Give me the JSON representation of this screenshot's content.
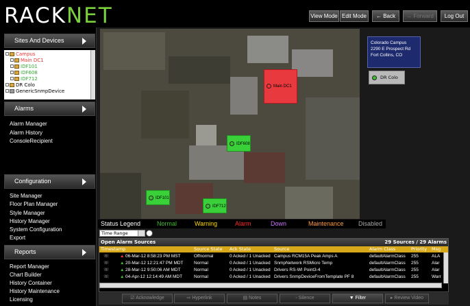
{
  "brand": {
    "logo_white": "RACK",
    "logo_green": "NET"
  },
  "topnav": {
    "view_mode": "View Mode",
    "edit_mode": "Edit Mode",
    "back": "← Back",
    "forward": "→ Forward",
    "logout": "Log Out"
  },
  "sidebar": {
    "sites_header": "Sites And Devices",
    "tree": [
      "Campus",
      "Main DC1",
      "IDF101",
      "IDF608",
      "IDF712",
      "DR Colo",
      "GenericSnmpDevice"
    ],
    "alarms_header": "Alarms",
    "alarm_links": [
      "Alarm Manager",
      "Alarm History",
      "ConsoleRecipient"
    ],
    "config_header": "Configuration",
    "config_links": [
      "Site Manager",
      "Floor Plan Manager",
      "Style Manager",
      "History Manager",
      "System Configuration",
      "Export"
    ],
    "reports_header": "Reports",
    "report_links": [
      "Report Manager",
      "Chart Builder",
      "History Container",
      "History Maintenance",
      "Licensing"
    ]
  },
  "map": {
    "location": {
      "name": "Colorado Campus",
      "address1": "2290 E Prospect Rd",
      "address2": "Fort Collins, CO"
    },
    "dr_colo": "DR Colo",
    "zones": {
      "main_dc1": "Main DC1",
      "idf608": "IDF608",
      "idf101": "IDF101",
      "idf712": "IDF712"
    }
  },
  "legend": {
    "title": "Status Legend",
    "normal": "Normal",
    "warning": "Warning",
    "alarm": "Alarm",
    "down": "Down",
    "maintenance": "Maintenance",
    "disabled": "Disabled"
  },
  "colors": {
    "normal": "#3fbf2f",
    "warning": "#ffd800",
    "alarm": "#ff2a2a",
    "down": "#d070ff",
    "maintenance": "#ff9a3c",
    "disabled": "#aaaaaa",
    "header_gold": "#d6a81a"
  },
  "time_range": "Time Range",
  "alarms_panel": {
    "title": "Open Alarm Sources",
    "count": "29 Sources / 29 Alarms",
    "columns": [
      "Timestamp",
      "Source State",
      "Ack State",
      "Source",
      "Alarm Class",
      "Priority",
      "Msg"
    ],
    "rows": [
      [
        "06-Mar-12 8:58:23 PM MST",
        "Offnormal",
        "0 Acked / 1 Unacked",
        "Campus RCM15A Peak Amps A",
        "defaultAlarmClass",
        "255",
        "ALA"
      ],
      [
        "20-Mar-12 12:21:47 PM MDT",
        "Normal",
        "0 Acked / 1 Unacked",
        "SnmpNetwork RSMicro Temp",
        "defaultAlarmClass",
        "255",
        "Alar"
      ],
      [
        "28-Mar-12 9:50:06 AM MDT",
        "Normal",
        "0 Acked / 1 Unacked",
        "Drivers RS-WI Point3-4",
        "defaultAlarmClass",
        "255",
        "Alar"
      ],
      [
        "04-Apr-12 12:14:49 AM MDT",
        "Normal",
        "0 Acked / 1 Unacked",
        "Drivers SnmpDeviceFromTemplate PF 8",
        "defaultAlarmClass",
        "255",
        "Warr"
      ]
    ]
  },
  "actions": {
    "acknowledge": "Acknowledge",
    "hyperlink": "Hyperlink",
    "notes": "Notes",
    "silence": "Silence",
    "filter": "Filter",
    "review_video": "Review Video"
  }
}
